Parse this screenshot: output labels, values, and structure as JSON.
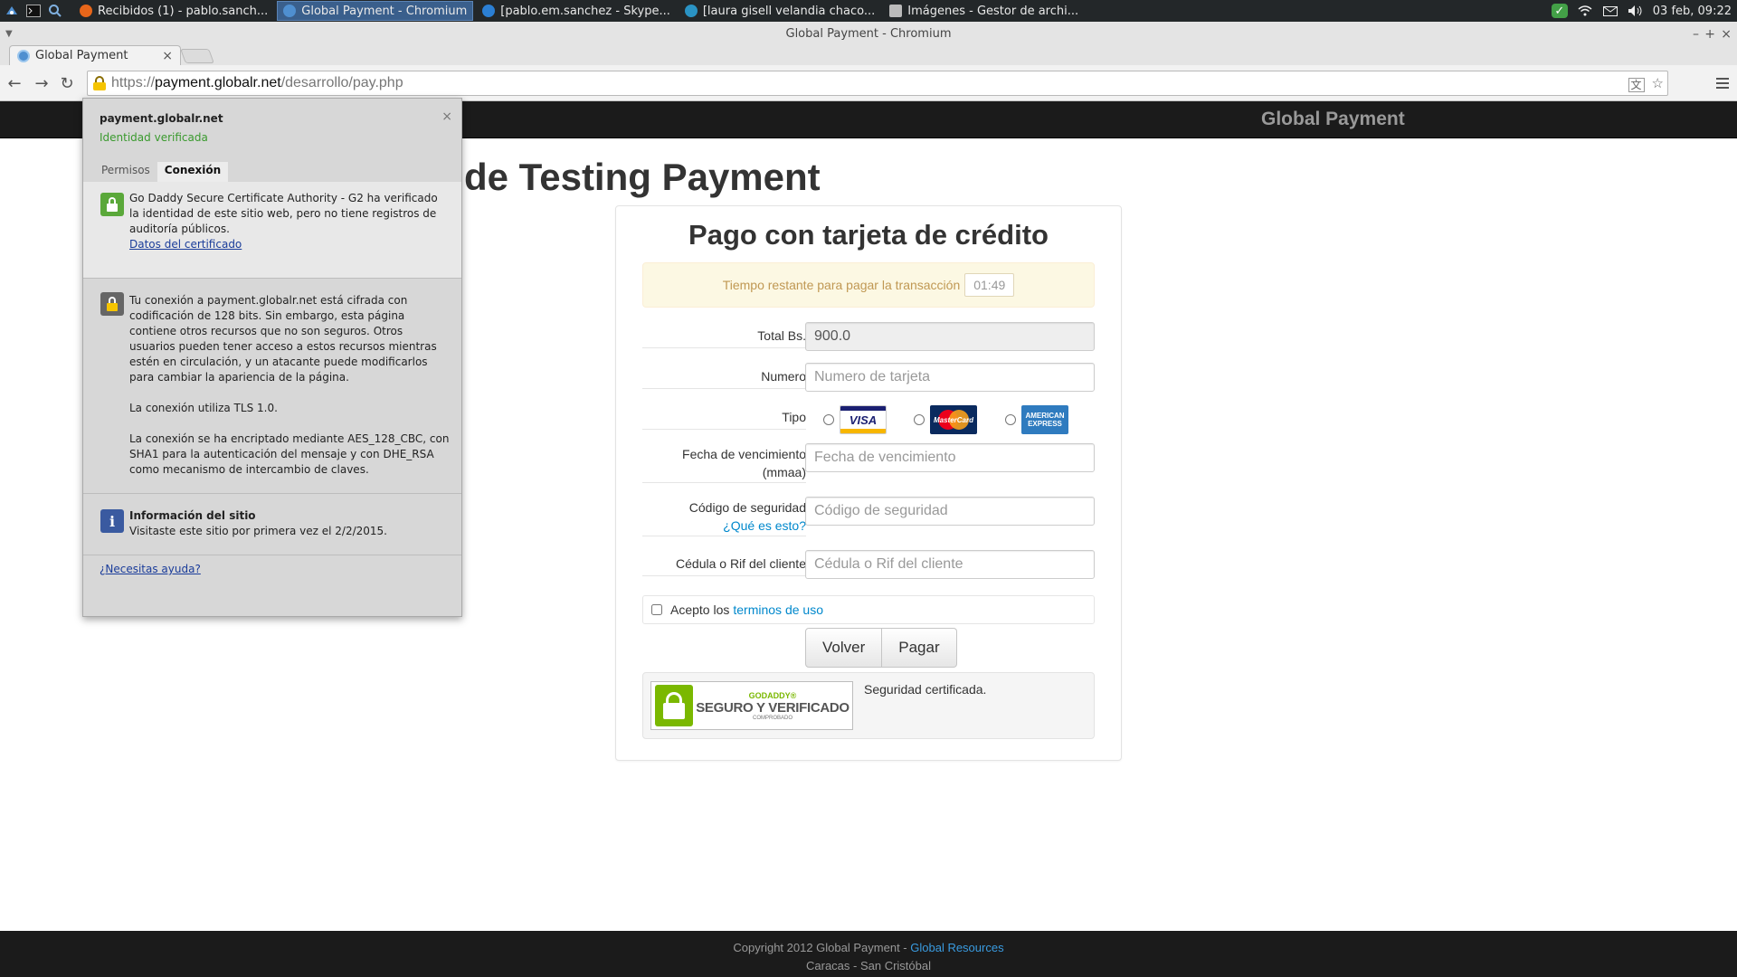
{
  "taskbar": {
    "tasks": [
      {
        "label": "Recibidos (1) - pablo.sanch...",
        "color": "#e8661a"
      },
      {
        "label": "Global Payment - Chromium",
        "color": "#4f8fd0"
      },
      {
        "label": "[pablo.em.sanchez - Skype...",
        "color": "#2b7fd4"
      },
      {
        "label": "[laura gisell velandia chaco...",
        "color": "#2a93c4"
      },
      {
        "label": "Imágenes - Gestor de archi...",
        "color": "#bbbbbb"
      }
    ],
    "clock": "03 feb, 09:22"
  },
  "window": {
    "title": "Global Payment - Chromium",
    "minimize": "–",
    "maximize": "+",
    "close": "×"
  },
  "tab": {
    "title": "Global Payment",
    "close": "×"
  },
  "toolbar": {
    "back": "←",
    "forward": "→",
    "reload": "↻",
    "url_scheme": "https://",
    "url_host": "payment.globalr.net",
    "url_path": "/desarrollo/pay.php"
  },
  "page": {
    "brand": "Global Payment",
    "heading": "de Testing Payment",
    "form": {
      "title": "Pago con tarjeta de crédito",
      "timer_label": "Tiempo restante para pagar la transacción",
      "timer_value": "01:49",
      "total_label": "Total Bs.",
      "total_value": "900.0",
      "numero_label": "Numero",
      "numero_placeholder": "Numero de tarjeta",
      "tipo_label": "Tipo",
      "card_types": {
        "visa": "VISA",
        "mastercard": "MasterCard",
        "amex": "AMERICAN EXPRESS"
      },
      "fecha_label_1": "Fecha de vencimiento",
      "fecha_label_2": "(mmaa)",
      "fecha_placeholder": "Fecha de vencimiento",
      "codigo_label": "Código de seguridad",
      "codigo_help": "¿Qué es esto?",
      "codigo_placeholder": "Código de seguridad",
      "cedula_label": "Cédula o Rif del cliente",
      "cedula_placeholder": "Cédula o Rif del cliente",
      "terms_prefix": "Acepto los",
      "terms_link": "terminos de uso",
      "back_button": "Volver",
      "pay_button": "Pagar",
      "seal_brand": "GODADDY®",
      "seal_main": "SEGURO Y VERIFICADO",
      "seal_sub": "COMPROBADO",
      "seal_caption": "Seguridad certificada."
    },
    "footer": {
      "copyright": "Copyright 2012 Global Payment -",
      "link": "Global Resources",
      "location": "Caracas - San Cristóbal"
    }
  },
  "bubble": {
    "host": "payment.globalr.net",
    "identity": "Identidad verificada",
    "close": "×",
    "tab_permissions": "Permisos",
    "tab_connection": "Conexión",
    "identity_text": "Go Daddy Secure Certificate Authority - G2 ha verificado la identidad de este sitio web, pero no tiene registros de auditoría públicos.",
    "cert_link": "Datos del certificado",
    "connection_p1": "Tu conexión a payment.globalr.net está cifrada con codificación de 128 bits. Sin embargo, esta página contiene otros recursos que no son seguros. Otros usuarios pueden tener acceso a estos recursos mientras estén en circulación, y un atacante puede modificarlos para cambiar la apariencia de la página.",
    "connection_p2": "La conexión utiliza TLS 1.0.",
    "connection_p3": "La conexión se ha encriptado mediante AES_128_CBC, con SHA1 para la autenticación del mensaje y con DHE_RSA como mecanismo de intercambio de claves.",
    "site_info_title": "Información del sitio",
    "site_info_text": "Visitaste este sitio por primera vez el 2/2/2015.",
    "help_link": "¿Necesitas ayuda?"
  }
}
